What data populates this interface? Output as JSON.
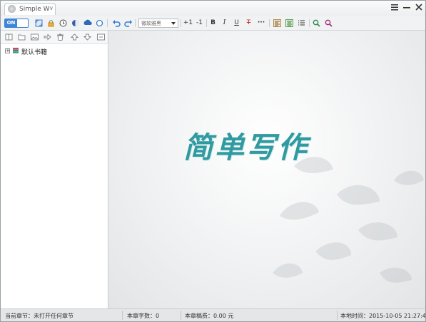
{
  "window": {
    "title": "Simple W"
  },
  "colors": {
    "accent": "#3d86d8",
    "brand": "#2f9aa0"
  },
  "toolbar": {
    "toggle_label": "ON",
    "font_select_value": "微软雅黑",
    "increase_label": "+1",
    "decrease_label": "-1",
    "bold_label": "B",
    "italic_label": "I",
    "underline_label": "U",
    "strike_label": "T",
    "more_label": "···",
    "icons": [
      "fullscreen-icon",
      "lock-icon",
      "clock-icon",
      "theme-icon",
      "cloud-icon",
      "circle-icon",
      "undo-icon",
      "redo-icon",
      "align-left-icon",
      "align-center-icon",
      "list-icon",
      "search-icon",
      "replace-icon"
    ]
  },
  "sidebar": {
    "tools": [
      "new-book-icon",
      "open-folder-icon",
      "image-icon",
      "export-icon",
      "delete-icon",
      "move-up-icon",
      "move-down-icon",
      "collapse-icon"
    ],
    "tree": [
      {
        "label": "默认书籍",
        "expander": "+"
      }
    ]
  },
  "editor": {
    "brand_text": "简单写作"
  },
  "status": {
    "current_chapter": "当前章节：未打开任何章节",
    "word_count": "本章字数：0",
    "chapter_fee": "本章稿费：0.00 元",
    "local_time": "本地时间：2015-10-05 21:27:44"
  }
}
